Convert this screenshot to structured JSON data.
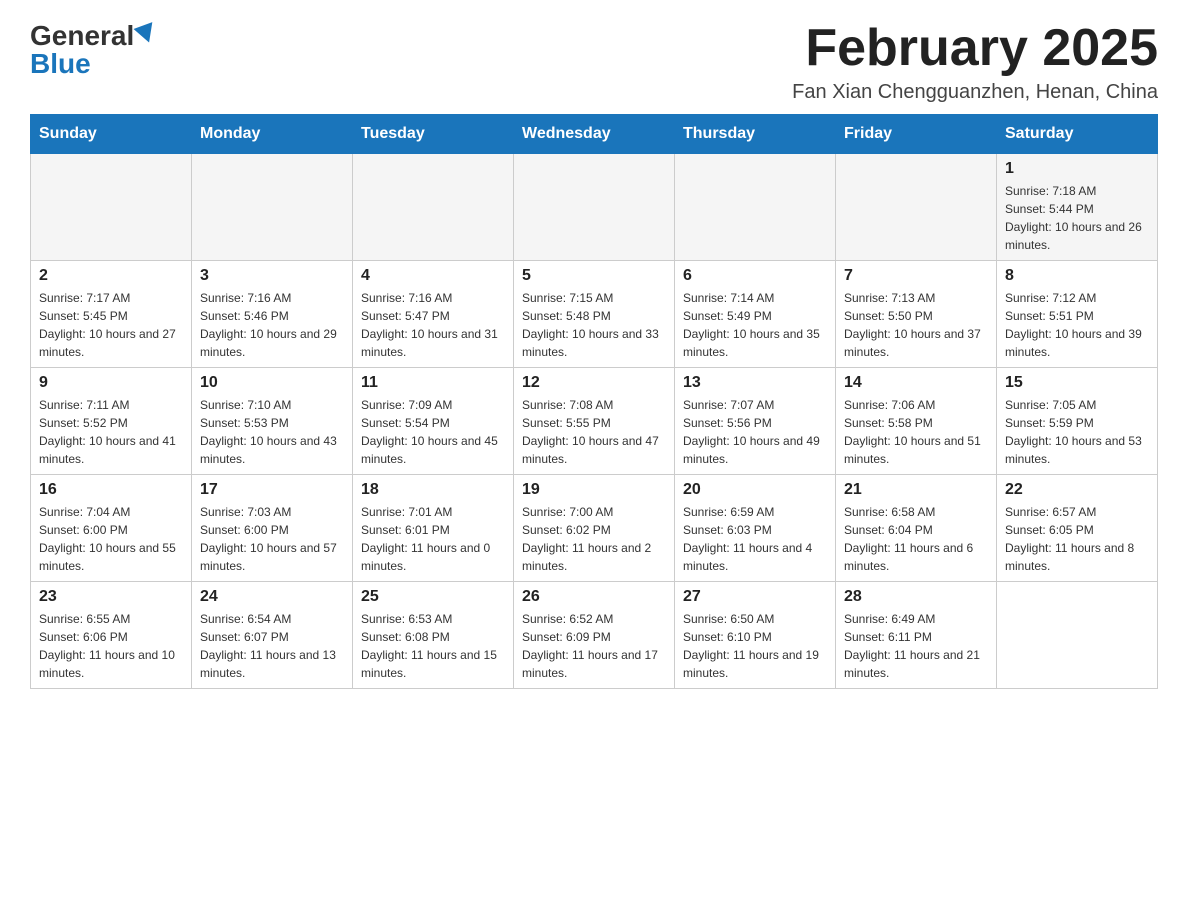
{
  "header": {
    "logo_general": "General",
    "logo_blue": "Blue",
    "month_title": "February 2025",
    "location": "Fan Xian Chengguanzhen, Henan, China"
  },
  "days_of_week": [
    "Sunday",
    "Monday",
    "Tuesday",
    "Wednesday",
    "Thursday",
    "Friday",
    "Saturday"
  ],
  "weeks": [
    {
      "days": [
        {
          "date": "",
          "info": ""
        },
        {
          "date": "",
          "info": ""
        },
        {
          "date": "",
          "info": ""
        },
        {
          "date": "",
          "info": ""
        },
        {
          "date": "",
          "info": ""
        },
        {
          "date": "",
          "info": ""
        },
        {
          "date": "1",
          "info": "Sunrise: 7:18 AM\nSunset: 5:44 PM\nDaylight: 10 hours and 26 minutes."
        }
      ]
    },
    {
      "days": [
        {
          "date": "2",
          "info": "Sunrise: 7:17 AM\nSunset: 5:45 PM\nDaylight: 10 hours and 27 minutes."
        },
        {
          "date": "3",
          "info": "Sunrise: 7:16 AM\nSunset: 5:46 PM\nDaylight: 10 hours and 29 minutes."
        },
        {
          "date": "4",
          "info": "Sunrise: 7:16 AM\nSunset: 5:47 PM\nDaylight: 10 hours and 31 minutes."
        },
        {
          "date": "5",
          "info": "Sunrise: 7:15 AM\nSunset: 5:48 PM\nDaylight: 10 hours and 33 minutes."
        },
        {
          "date": "6",
          "info": "Sunrise: 7:14 AM\nSunset: 5:49 PM\nDaylight: 10 hours and 35 minutes."
        },
        {
          "date": "7",
          "info": "Sunrise: 7:13 AM\nSunset: 5:50 PM\nDaylight: 10 hours and 37 minutes."
        },
        {
          "date": "8",
          "info": "Sunrise: 7:12 AM\nSunset: 5:51 PM\nDaylight: 10 hours and 39 minutes."
        }
      ]
    },
    {
      "days": [
        {
          "date": "9",
          "info": "Sunrise: 7:11 AM\nSunset: 5:52 PM\nDaylight: 10 hours and 41 minutes."
        },
        {
          "date": "10",
          "info": "Sunrise: 7:10 AM\nSunset: 5:53 PM\nDaylight: 10 hours and 43 minutes."
        },
        {
          "date": "11",
          "info": "Sunrise: 7:09 AM\nSunset: 5:54 PM\nDaylight: 10 hours and 45 minutes."
        },
        {
          "date": "12",
          "info": "Sunrise: 7:08 AM\nSunset: 5:55 PM\nDaylight: 10 hours and 47 minutes."
        },
        {
          "date": "13",
          "info": "Sunrise: 7:07 AM\nSunset: 5:56 PM\nDaylight: 10 hours and 49 minutes."
        },
        {
          "date": "14",
          "info": "Sunrise: 7:06 AM\nSunset: 5:58 PM\nDaylight: 10 hours and 51 minutes."
        },
        {
          "date": "15",
          "info": "Sunrise: 7:05 AM\nSunset: 5:59 PM\nDaylight: 10 hours and 53 minutes."
        }
      ]
    },
    {
      "days": [
        {
          "date": "16",
          "info": "Sunrise: 7:04 AM\nSunset: 6:00 PM\nDaylight: 10 hours and 55 minutes."
        },
        {
          "date": "17",
          "info": "Sunrise: 7:03 AM\nSunset: 6:00 PM\nDaylight: 10 hours and 57 minutes."
        },
        {
          "date": "18",
          "info": "Sunrise: 7:01 AM\nSunset: 6:01 PM\nDaylight: 11 hours and 0 minutes."
        },
        {
          "date": "19",
          "info": "Sunrise: 7:00 AM\nSunset: 6:02 PM\nDaylight: 11 hours and 2 minutes."
        },
        {
          "date": "20",
          "info": "Sunrise: 6:59 AM\nSunset: 6:03 PM\nDaylight: 11 hours and 4 minutes."
        },
        {
          "date": "21",
          "info": "Sunrise: 6:58 AM\nSunset: 6:04 PM\nDaylight: 11 hours and 6 minutes."
        },
        {
          "date": "22",
          "info": "Sunrise: 6:57 AM\nSunset: 6:05 PM\nDaylight: 11 hours and 8 minutes."
        }
      ]
    },
    {
      "days": [
        {
          "date": "23",
          "info": "Sunrise: 6:55 AM\nSunset: 6:06 PM\nDaylight: 11 hours and 10 minutes."
        },
        {
          "date": "24",
          "info": "Sunrise: 6:54 AM\nSunset: 6:07 PM\nDaylight: 11 hours and 13 minutes."
        },
        {
          "date": "25",
          "info": "Sunrise: 6:53 AM\nSunset: 6:08 PM\nDaylight: 11 hours and 15 minutes."
        },
        {
          "date": "26",
          "info": "Sunrise: 6:52 AM\nSunset: 6:09 PM\nDaylight: 11 hours and 17 minutes."
        },
        {
          "date": "27",
          "info": "Sunrise: 6:50 AM\nSunset: 6:10 PM\nDaylight: 11 hours and 19 minutes."
        },
        {
          "date": "28",
          "info": "Sunrise: 6:49 AM\nSunset: 6:11 PM\nDaylight: 11 hours and 21 minutes."
        },
        {
          "date": "",
          "info": ""
        }
      ]
    }
  ]
}
